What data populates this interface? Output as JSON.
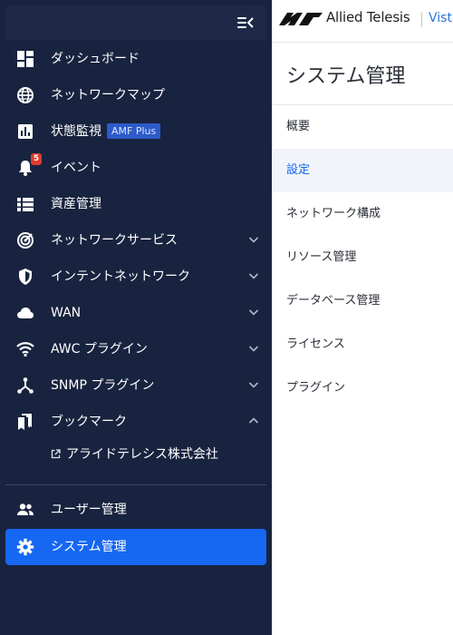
{
  "sidebar": {
    "items": [
      {
        "label": "ダッシュボード"
      },
      {
        "label": "ネットワークマップ"
      },
      {
        "label": "状態監視",
        "badge": "AMF Plus"
      },
      {
        "label": "イベント",
        "count": "5"
      },
      {
        "label": "資産管理"
      },
      {
        "label": "ネットワークサービス"
      },
      {
        "label": "インテントネットワーク"
      },
      {
        "label": "WAN"
      },
      {
        "label": "AWC プラグイン"
      },
      {
        "label": "SNMP プラグイン"
      },
      {
        "label": "ブックマーク"
      }
    ],
    "bookmark": {
      "label": "アライドテレシス株式会社"
    },
    "bottom": [
      {
        "label": "ユーザー管理"
      },
      {
        "label": "システム管理"
      }
    ]
  },
  "header": {
    "brand": "Allied Telesis",
    "product": "Vista"
  },
  "page": {
    "title": "システム管理",
    "menu": [
      {
        "label": "概要"
      },
      {
        "label": "設定"
      },
      {
        "label": "ネットワーク構成"
      },
      {
        "label": "リソース管理"
      },
      {
        "label": "データベース管理"
      },
      {
        "label": "ライセンス"
      },
      {
        "label": "プラグイン"
      }
    ]
  },
  "colors": {
    "sidebar": "#18233f",
    "accent": "#1667f2",
    "badge": "#2d5ac9",
    "alert": "#e03b2f"
  }
}
